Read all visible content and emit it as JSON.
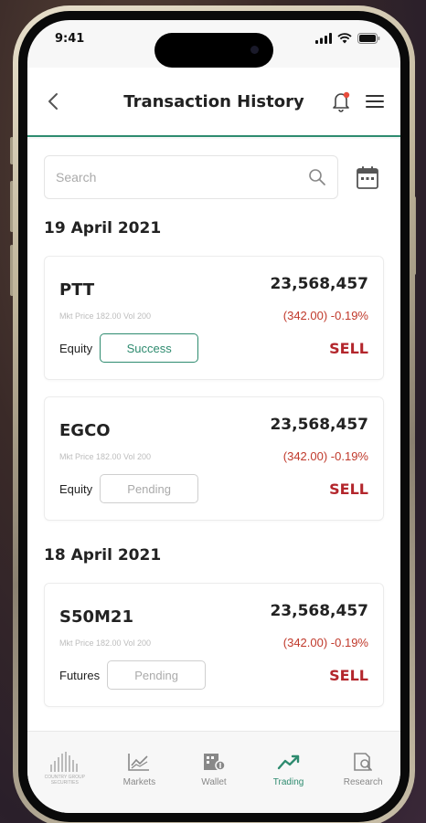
{
  "status": {
    "time": "9:41"
  },
  "header": {
    "title": "Transaction History"
  },
  "search": {
    "placeholder": "Search"
  },
  "groups": [
    {
      "date": "19 April 2021",
      "items": [
        {
          "symbol": "PTT",
          "amount": "23,568,457",
          "mkt": "Mkt Price 182.00 Vol 200",
          "change": "(342.00) -0.19%",
          "type": "Equity",
          "status": "Success",
          "side": "SELL"
        },
        {
          "symbol": "EGCO",
          "amount": "23,568,457",
          "mkt": "Mkt Price 182.00 Vol 200",
          "change": "(342.00) -0.19%",
          "type": "Equity",
          "status": "Pending",
          "side": "SELL"
        }
      ]
    },
    {
      "date": "18 April 2021",
      "items": [
        {
          "symbol": "S50M21",
          "amount": "23,568,457",
          "mkt": "Mkt Price 182.00 Vol 200",
          "change": "(342.00) -0.19%",
          "type": "Futures",
          "status": "Pending",
          "side": "SELL"
        }
      ]
    }
  ],
  "tabbar": {
    "logo_text": "COUNTRY GROUP SECURITIES",
    "tabs": [
      {
        "label": "Markets",
        "icon": "chart-line-icon"
      },
      {
        "label": "Wallet",
        "icon": "wallet-icon"
      },
      {
        "label": "Trading",
        "icon": "trending-up-icon"
      },
      {
        "label": "Research",
        "icon": "research-icon"
      }
    ]
  },
  "colors": {
    "accent": "#2e8b6f",
    "sell": "#b3262c",
    "negative": "#c0392b"
  }
}
